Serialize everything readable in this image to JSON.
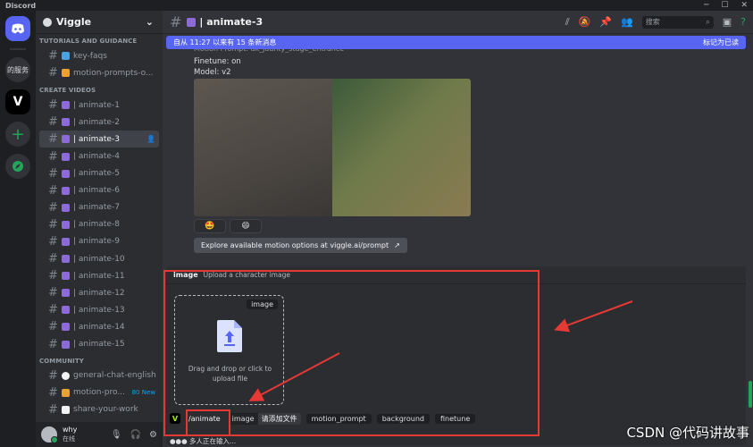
{
  "window": {
    "app_name": "Discord"
  },
  "rail": {
    "text_server": "的服务",
    "viggle_letter": "V"
  },
  "guild": {
    "name": "Viggle"
  },
  "sidebar": {
    "categories": [
      "TUTORIALS AND GUIDANCE",
      "CREATE VIDEOS",
      "COMMUNITY"
    ],
    "tutorial_channels": [
      {
        "label": "key-faqs"
      },
      {
        "label": "motion-prompts-o..."
      }
    ],
    "create_channels": [
      {
        "label": "| animate-1"
      },
      {
        "label": "| animate-2"
      },
      {
        "label": "| animate-3"
      },
      {
        "label": "| animate-4"
      },
      {
        "label": "| animate-5"
      },
      {
        "label": "| animate-6"
      },
      {
        "label": "| animate-7"
      },
      {
        "label": "| animate-8"
      },
      {
        "label": "| animate-9"
      },
      {
        "label": "| animate-10"
      },
      {
        "label": "| animate-11"
      },
      {
        "label": "| animate-12"
      },
      {
        "label": "| animate-13"
      },
      {
        "label": "| animate-14"
      },
      {
        "label": "| animate-15"
      }
    ],
    "community_channels": [
      {
        "label": "general-chat-english"
      },
      {
        "label": "motion-pro...",
        "badge": "80 New"
      },
      {
        "label": "share-your-work"
      }
    ]
  },
  "user": {
    "name": "why",
    "status": "在线"
  },
  "header": {
    "channel": "| animate-3",
    "search_placeholder": "搜索"
  },
  "new_messages": {
    "text": "自从 11:27 以来有 15 条新消息",
    "action": "标记为已读"
  },
  "message": {
    "line_partial": "Motion Prompt: ak_jaunty_stage_entrance",
    "finetune": "Finetune: on",
    "model": "Model: v2",
    "reactions": [
      "🤩",
      "😄"
    ],
    "explore_button": "Explore available motion options at viggle.ai/prompt"
  },
  "command_panel": {
    "option_name": "image",
    "option_desc": "Upload a character image",
    "dropzone_label": "image",
    "dropzone_text_1": "Drag and drop or click to",
    "dropzone_text_2": "upload file",
    "command": "/animate",
    "chip_image_key": "image",
    "chip_image_value": "请添加文件",
    "chip_motion": "motion_prompt",
    "chip_background": "background",
    "chip_finetune": "finetune"
  },
  "typing": "●●● 多人正在输入...",
  "watermark": "CSDN @代码讲故事",
  "colors": {
    "blurple": "#5865f2",
    "annotation_red": "#e53935",
    "online_green": "#23a55a"
  }
}
